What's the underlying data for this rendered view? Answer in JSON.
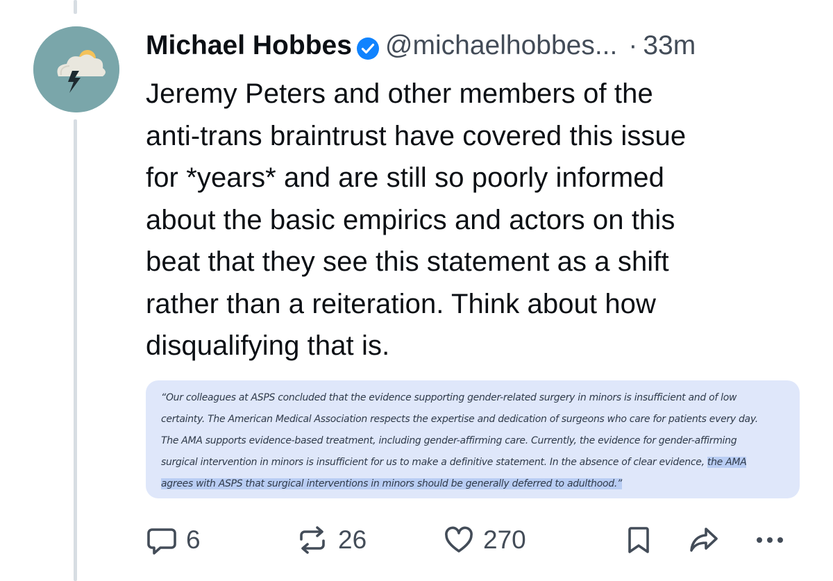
{
  "post": {
    "author": {
      "display_name": "Michael Hobbes",
      "handle": "@michaelhobbes...",
      "verified": true
    },
    "separator": "·",
    "timestamp": "33m",
    "text_lines": [
      "Jeremy Peters and other members of the",
      "anti-trans braintrust have covered this issue",
      "for *years* and are still so poorly informed",
      "about the basic empirics and actors on this",
      "beat that they see this statement as a shift",
      "rather than a reiteration. Think about how",
      "disqualifying that is."
    ],
    "quote_image": {
      "lines": [
        "“Our colleagues at ASPS concluded that the evidence supporting gender-related surgery in minors is insufficient and of low",
        "certainty. The American Medical Association respects the expertise and dedication of surgeons who care for patients every day.",
        "The AMA supports evidence-based treatment, including gender-affirming care. Currently, the evidence for gender-affirming",
        "surgical intervention in minors is insufficient for us to make a definitive statement. In the absence of clear evidence, "
      ],
      "highlight_line4": "the AMA",
      "highlight_line5": "agrees with ASPS that surgical interventions in minors should be generally deferred to adulthood.”"
    },
    "actions": {
      "reply_count": "6",
      "repost_count": "26",
      "like_count": "270"
    },
    "colors": {
      "avatar_bg": "#7aa6aa",
      "verified_blue": "#1083fe",
      "quote_bg": "#dfe7fa",
      "highlight": "#b9cdf3",
      "muted_text": "#434c58"
    },
    "icons": {
      "avatar": "storm-cloud-lightning-icon",
      "reply": "speech-bubble-icon",
      "repost": "repost-arrows-icon",
      "like": "heart-icon",
      "bookmark": "bookmark-icon",
      "share": "share-arrow-icon",
      "more": "ellipsis-icon"
    }
  }
}
